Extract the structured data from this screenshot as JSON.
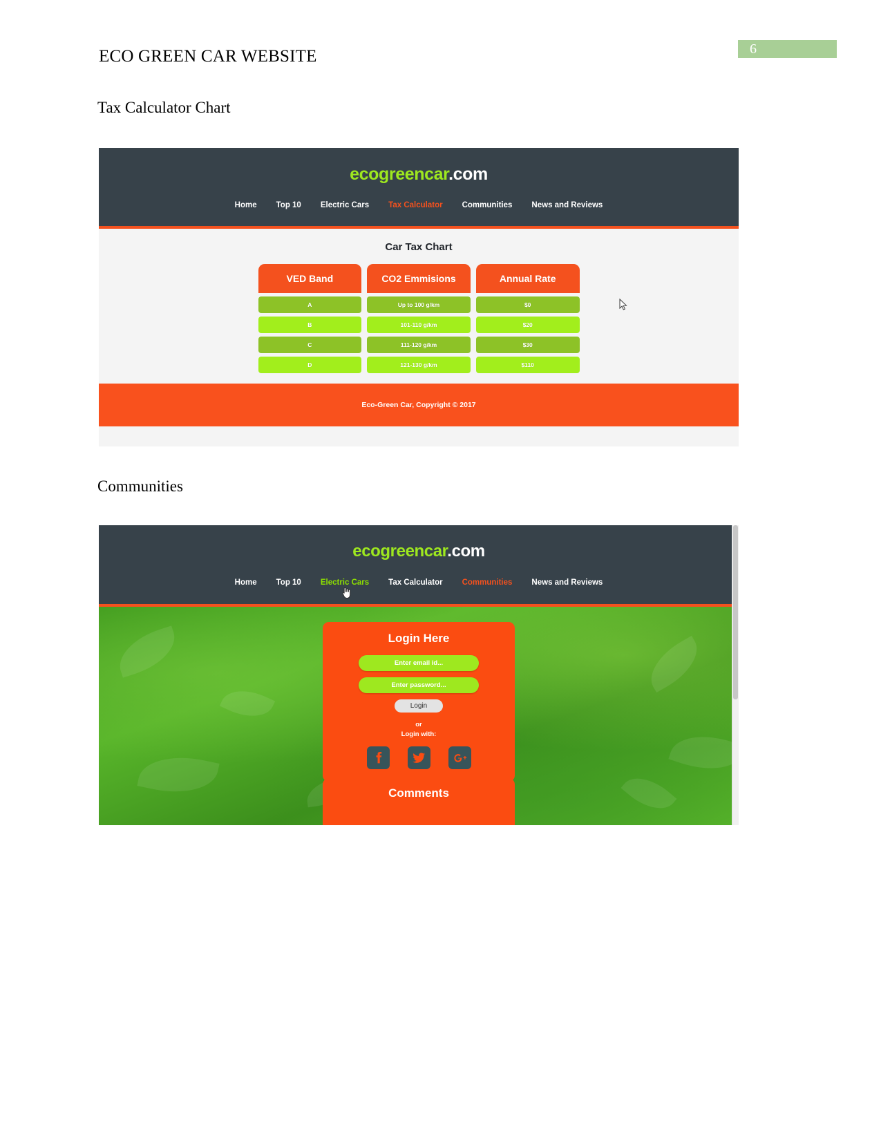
{
  "document": {
    "header_title": "ECO GREEN CAR WEBSITE",
    "page_number": "6",
    "section_1_title": "Tax Calculator Chart",
    "section_2_title": "Communities"
  },
  "site": {
    "logo_green": "ecogreencar",
    "logo_white": ".com",
    "footer_text": "Eco-Green Car, Copyright © 2017"
  },
  "screenshot_tax": {
    "nav": [
      {
        "label": "Home",
        "state": "normal"
      },
      {
        "label": "Top 10",
        "state": "normal"
      },
      {
        "label": "Electric Cars",
        "state": "normal"
      },
      {
        "label": "Tax Calculator",
        "state": "active"
      },
      {
        "label": "Communities",
        "state": "normal"
      },
      {
        "label": "News and Reviews",
        "state": "normal"
      }
    ],
    "chart_title": "Car Tax Chart",
    "headers": [
      "VED Band",
      "CO2 Emmisions",
      "Annual Rate"
    ],
    "rows": [
      {
        "band": "A",
        "emissions": "Up to 100 g/km",
        "rate": "$0"
      },
      {
        "band": "B",
        "emissions": "101-110 g/km",
        "rate": "$20"
      },
      {
        "band": "C",
        "emissions": "111-120 g/km",
        "rate": "$30"
      },
      {
        "band": "D",
        "emissions": "121-130 g/km",
        "rate": "$110"
      }
    ]
  },
  "screenshot_communities": {
    "nav": [
      {
        "label": "Home",
        "state": "normal"
      },
      {
        "label": "Top 10",
        "state": "normal"
      },
      {
        "label": "Electric Cars",
        "state": "hover"
      },
      {
        "label": "Tax Calculator",
        "state": "normal"
      },
      {
        "label": "Communities",
        "state": "active"
      },
      {
        "label": "News and Reviews",
        "state": "normal"
      }
    ],
    "login": {
      "title": "Login Here",
      "email_placeholder": "Enter email id...",
      "password_placeholder": "Enter password...",
      "button_label": "Login",
      "or_label": "or",
      "login_with_label": "Login with:",
      "socials": [
        "facebook-icon",
        "twitter-icon",
        "google-plus-icon"
      ]
    },
    "comments_title": "Comments"
  },
  "chart_data": {
    "type": "table",
    "title": "Car Tax Chart",
    "columns": [
      "VED Band",
      "CO2 Emmisions",
      "Annual Rate"
    ],
    "rows": [
      [
        "A",
        "Up to 100 g/km",
        "$0"
      ],
      [
        "B",
        "101-110 g/km",
        "$20"
      ],
      [
        "C",
        "111-120 g/km",
        "$30"
      ],
      [
        "D",
        "121-130 g/km",
        "$110"
      ]
    ],
    "annual_rate_values": [
      0,
      20,
      30,
      110
    ],
    "co2_lower_bounds_gkm": [
      0,
      101,
      111,
      121
    ],
    "co2_upper_bounds_gkm": [
      100,
      110,
      120,
      130
    ],
    "xlabel": "VED Band",
    "ylabel": "Annual Rate ($)"
  },
  "colors": {
    "header_dark": "#37424a",
    "accent_orange": "#f4511e",
    "logo_green": "#9ee81f",
    "row_green_dark": "#8dc227",
    "row_green_light": "#a2ee1c",
    "page_band_green": "#a8cf96"
  }
}
